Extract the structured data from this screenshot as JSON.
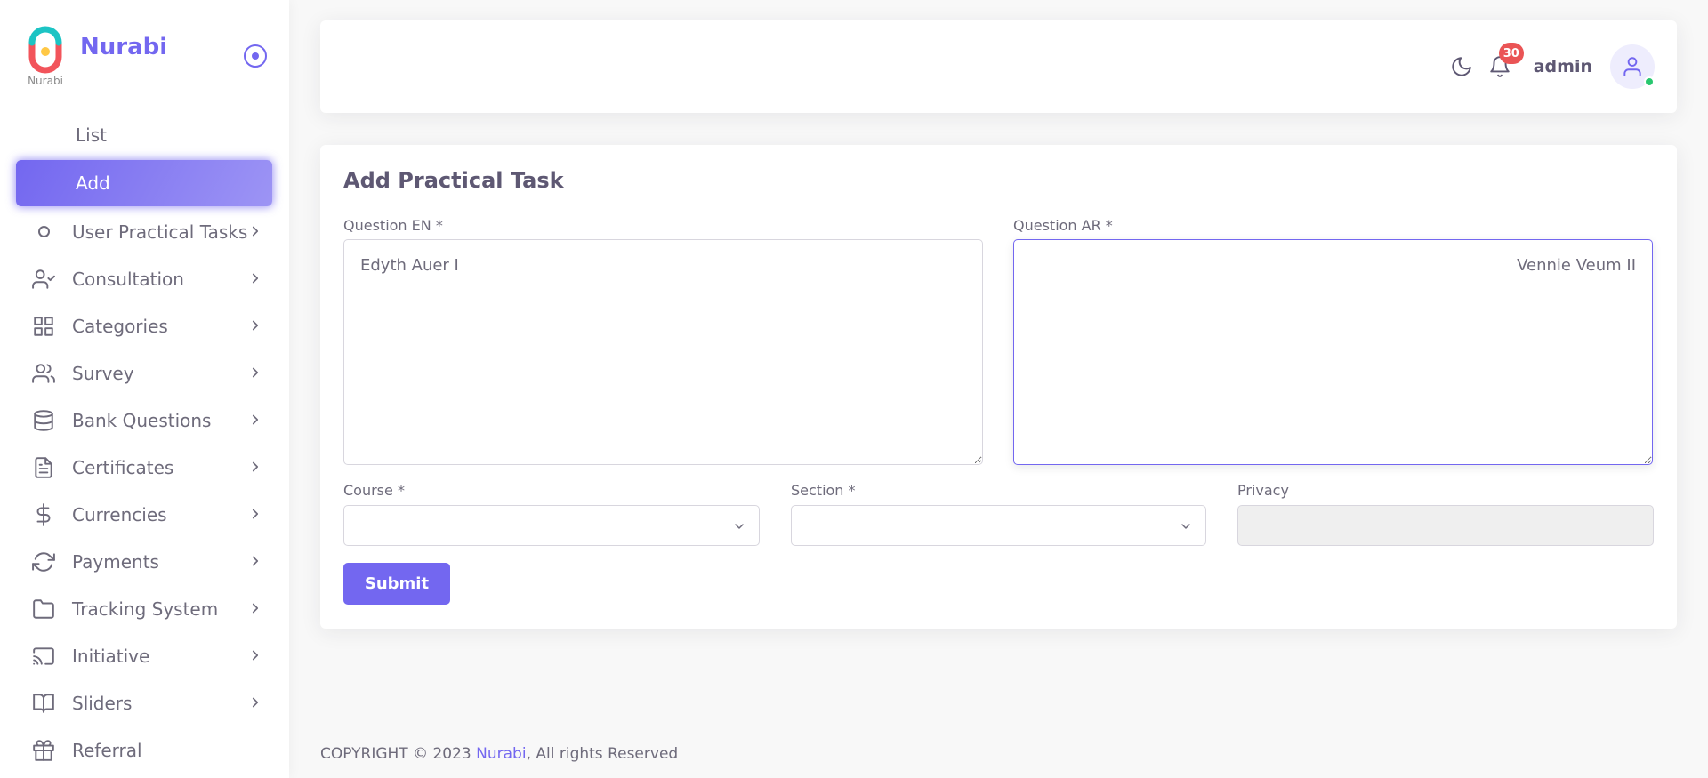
{
  "brand": {
    "name": "Nurabi",
    "caption": "Nurabi"
  },
  "sidebar": {
    "sub_items": [
      {
        "label": "List",
        "active": false
      },
      {
        "label": "Add",
        "active": true
      }
    ],
    "items": [
      {
        "label": "User Practical Tasks",
        "icon": "circle-bullet-icon"
      },
      {
        "label": "Consultation",
        "icon": "user-check-icon"
      },
      {
        "label": "Categories",
        "icon": "grid-icon"
      },
      {
        "label": "Survey",
        "icon": "users-icon"
      },
      {
        "label": "Bank Questions",
        "icon": "database-icon"
      },
      {
        "label": "Certificates",
        "icon": "file-text-icon"
      },
      {
        "label": "Currencies",
        "icon": "dollar-sign-icon"
      },
      {
        "label": "Payments",
        "icon": "refresh-icon"
      },
      {
        "label": "Tracking System",
        "icon": "folder-icon"
      },
      {
        "label": "Initiative",
        "icon": "cast-icon"
      },
      {
        "label": "Sliders",
        "icon": "book-open-icon"
      },
      {
        "label": "Referral",
        "icon": "gift-icon"
      }
    ]
  },
  "navbar": {
    "notifications_count": "30",
    "user_name": "admin"
  },
  "form": {
    "title": "Add Practical Task",
    "question_en": {
      "label": "Question EN *",
      "value": "Edyth Auer I"
    },
    "question_ar": {
      "label": "Question AR *",
      "value": "Vennie Veum II"
    },
    "course": {
      "label": "Course *",
      "value": ""
    },
    "section": {
      "label": "Section *",
      "value": ""
    },
    "privacy": {
      "label": "Privacy",
      "value": ""
    },
    "submit_label": "Submit"
  },
  "footer": {
    "prefix": "COPYRIGHT © 2023 ",
    "link": "Nurabi",
    "suffix": ", All rights Reserved"
  },
  "colors": {
    "primary": "#7367f0",
    "danger": "#ea5455",
    "success": "#28c76f"
  }
}
